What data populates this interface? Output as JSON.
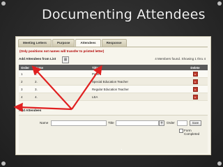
{
  "slide": {
    "title": "Documenting Attendees"
  },
  "tabs": [
    {
      "label": "Meeting Letters",
      "active": false
    },
    {
      "label": "Purpose",
      "active": false
    },
    {
      "label": "Attendees",
      "active": true
    },
    {
      "label": "Response",
      "active": false
    }
  ],
  "note": "(Only positions not names will transfer to printed letter)",
  "list_section": {
    "header": "Add Attendees from List",
    "found_text": "4 Members found. Showing 1 thru 4",
    "columns": {
      "order": "Order",
      "name": "Name",
      "title": "Title",
      "delete": "Delete"
    },
    "rows": [
      {
        "order": "1",
        "name": "1.",
        "title": "Parent"
      },
      {
        "order": "2",
        "name": "2.",
        "title": "Special Education Teacher"
      },
      {
        "order": "3",
        "name": "3.",
        "title": "Regular Education Teacher"
      },
      {
        "order": "4",
        "name": "4.",
        "title": "LEA"
      }
    ],
    "delete_glyph": "x"
  },
  "add_section": {
    "header": "Add Attendees",
    "name_label": "Name",
    "title_label": "Title",
    "order_label": "Order",
    "save_label": "Save",
    "form_completed_label": "Form Completed",
    "name_value": "",
    "title_value": "",
    "order_value": ""
  },
  "colors": {
    "background": "#2b2b2b",
    "arrow": "#e02020",
    "panel": "#f7f5ec",
    "header_bar": "#5a5a5a"
  }
}
